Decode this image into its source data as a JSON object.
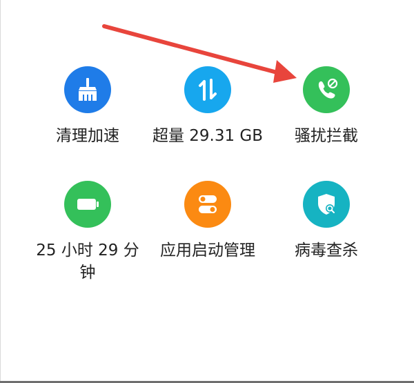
{
  "colors": {
    "blue": "#1f7ce8",
    "lightblue": "#17a7ee",
    "green": "#34c05a",
    "orange": "#fb8a12",
    "teal": "#16b3c2",
    "arrow": "#e8453c"
  },
  "tiles": [
    {
      "label": "清理加速",
      "icon": "broom-icon"
    },
    {
      "label": "超量 29.31 GB",
      "icon": "data-transfer-icon"
    },
    {
      "label": "骚扰拦截",
      "icon": "call-block-icon"
    },
    {
      "label": "25 小时 29 分钟",
      "icon": "battery-icon"
    },
    {
      "label": "应用启动管理",
      "icon": "toggle-switch-icon"
    },
    {
      "label": "病毒查杀",
      "icon": "shield-search-icon"
    }
  ]
}
